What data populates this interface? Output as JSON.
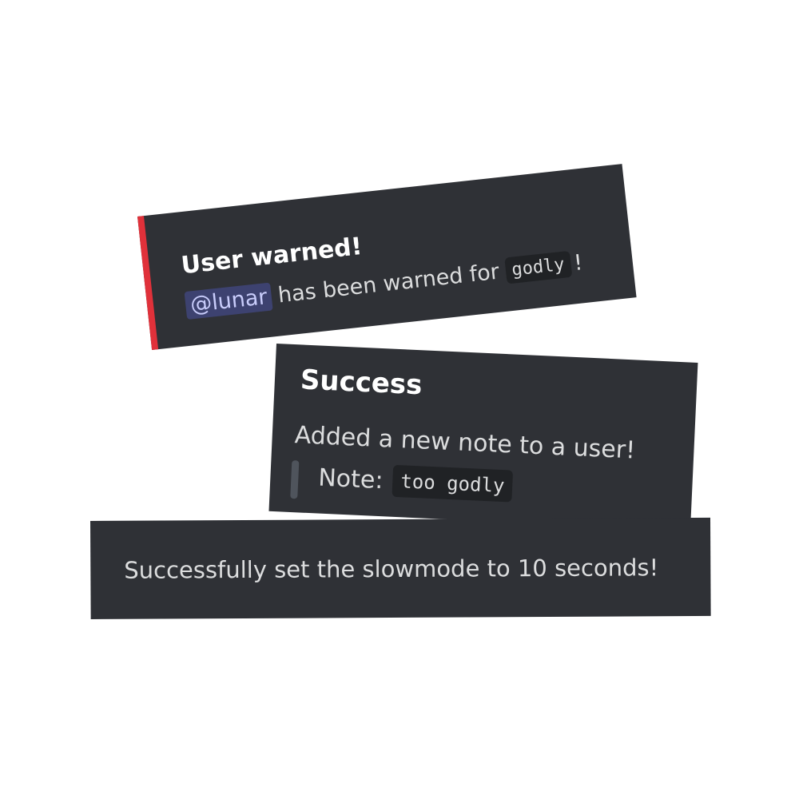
{
  "warned_card": {
    "title": "User warned!",
    "mention": "@lunar",
    "text_fragment": "has been warned for",
    "reason_code": "godly",
    "trailing": "!",
    "accent_color": "#e0313a"
  },
  "success_card": {
    "title": "Success",
    "description": "Added a new note to a user!",
    "note_label": "Note:",
    "note_code": "too godly"
  },
  "slowmode_card": {
    "message": "Successfully set the slowmode to 10 seconds!"
  },
  "colors": {
    "embed_bg": "#2f3136",
    "code_bg": "#202225",
    "mention_bg": "#3d4270"
  }
}
